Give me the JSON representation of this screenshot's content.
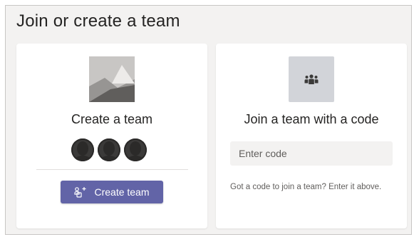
{
  "page": {
    "title": "Join or create a team"
  },
  "create_card": {
    "title": "Create a team",
    "button_label": "Create team"
  },
  "join_card": {
    "title": "Join a team with a code",
    "input_placeholder": "Enter code",
    "input_value": "",
    "hint": "Got a code to join a team? Enter it above."
  },
  "icons": {
    "create_thumbnail": "landscape-placeholder-icon",
    "join_thumbnail": "people-group-icon",
    "create_button_icon": "add-team-icon",
    "avatar": "person-silhouette-icon"
  },
  "colors": {
    "accent": "#6264a7",
    "background": "#f3f2f1",
    "card": "#ffffff",
    "text": "#252423",
    "muted": "#605e5c"
  }
}
